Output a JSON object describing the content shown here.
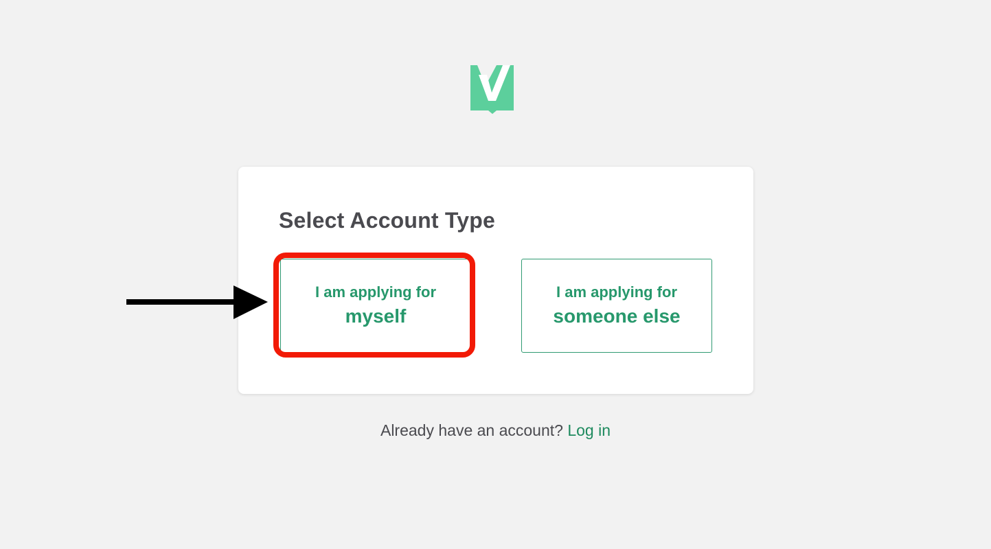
{
  "brand": {
    "logo_icon": "checkmark-badge-icon",
    "logo_color": "#5ccf9c"
  },
  "card": {
    "title": "Select Account Type"
  },
  "options": [
    {
      "line1": "I am applying for",
      "line2": "myself"
    },
    {
      "line1": "I am applying for",
      "line2": "someone else"
    }
  ],
  "annotation": {
    "arrow_icon": "arrow-right-icon",
    "highlight_color": "#f21a06"
  },
  "footer": {
    "prompt": "Already have an account?",
    "login_label": "Log in"
  },
  "colors": {
    "accent": "#27986c",
    "background": "#f2f2f2",
    "text": "#4a4a4f"
  }
}
